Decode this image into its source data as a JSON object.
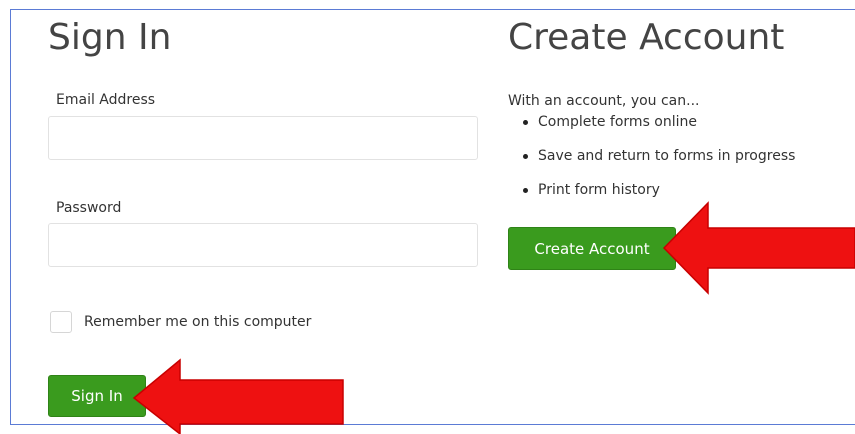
{
  "signin": {
    "title": "Sign In",
    "email_label": "Email Address",
    "email_value": "",
    "email_placeholder": "",
    "password_label": "Password",
    "password_value": "",
    "password_placeholder": "",
    "remember_label": "Remember me on this computer",
    "remember_checked": false,
    "button_label": "Sign In"
  },
  "create": {
    "title": "Create Account",
    "intro": "With an account, you can...",
    "benefits": [
      "Complete forms online",
      "Save and return to forms in progress",
      "Print form history"
    ],
    "button_label": "Create Account"
  },
  "colors": {
    "button_green": "#3a9b1e",
    "arrow_red": "#ee1111",
    "frame_blue": "#5b7bd5"
  }
}
